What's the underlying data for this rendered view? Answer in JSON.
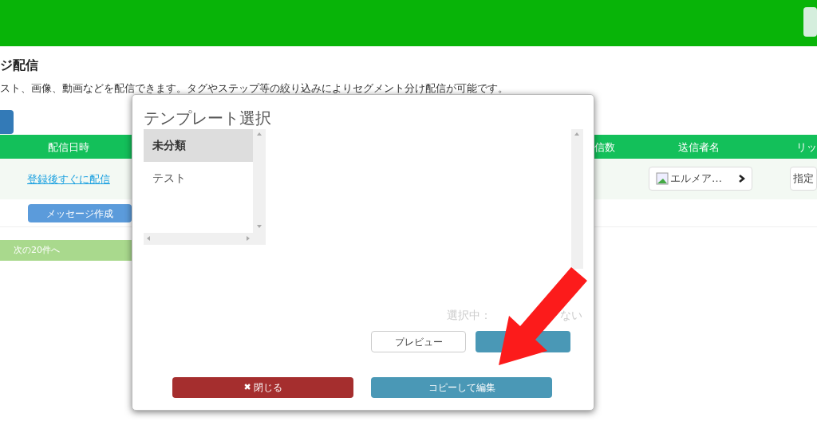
{
  "page_title": "ジ配信",
  "description": "スト、画像、動画などを配信できます。タグやステップ等の絞り込みによりセグメント分け配信が可能です。",
  "table": {
    "columns": [
      "配信日時",
      "信数",
      "送信者名",
      "リッ"
    ],
    "rows": [
      {
        "delivery_time": "登録後すぐに配信",
        "sender": "エルメア…",
        "column_4": "指定"
      }
    ]
  },
  "create_button": "メッセージ作成",
  "next_button": "次の20件へ",
  "modal": {
    "title": "テンプレート選択",
    "categories": [
      {
        "label": "未分類",
        "selected": true
      },
      {
        "label": "テスト",
        "selected": false
      }
    ],
    "selection_text": [
      "選択中：",
      "ない"
    ],
    "preview_button": "プレビュー",
    "close_button": {
      "icon": "✖",
      "label": "閉じる"
    },
    "copy_button": "コピーして編集"
  }
}
